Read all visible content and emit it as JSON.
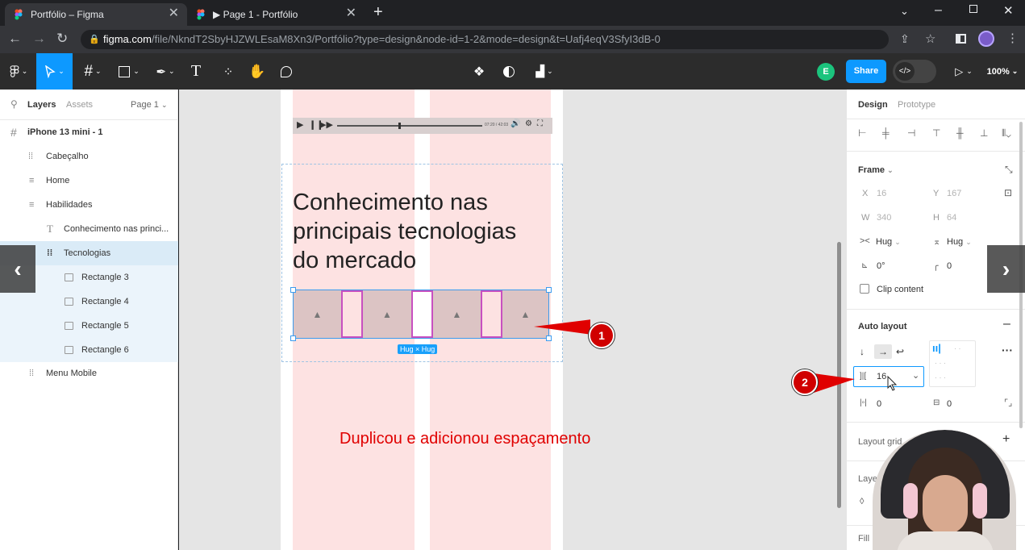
{
  "browser": {
    "tabs": [
      {
        "title": "Portfólio – Figma",
        "active": true
      },
      {
        "title": "▶ Page 1 - Portfólio",
        "active": false
      }
    ],
    "url_host": "figma.com",
    "url_path": "/file/NkndT2SbyHJZWLEsaM8Xn3/Portfólio?type=design&node-id=1-2&mode=design&t=Uafj4eqV3SfyI3dB-0"
  },
  "toolbar": {
    "share_label": "Share",
    "zoom": "100%",
    "avatar_letter": "E"
  },
  "left_panel": {
    "tab_layers": "Layers",
    "tab_assets": "Assets",
    "page_selector": "Page 1",
    "layers": [
      {
        "label": "iPhone 13 mini - 1",
        "icon": "frame-icon"
      },
      {
        "label": "Cabeçalho",
        "icon": "autolayout-icon"
      },
      {
        "label": "Home",
        "icon": "autolayout-icon"
      },
      {
        "label": "Habilidades",
        "icon": "autolayout-icon"
      },
      {
        "label": "Conhecimento nas princi...",
        "icon": "text-icon"
      },
      {
        "label": "Tecnologias",
        "icon": "autolayout-icon"
      },
      {
        "label": "Rectangle 3",
        "icon": "image-icon"
      },
      {
        "label": "Rectangle 4",
        "icon": "image-icon"
      },
      {
        "label": "Rectangle 5",
        "icon": "image-icon"
      },
      {
        "label": "Rectangle 6",
        "icon": "image-icon"
      },
      {
        "label": "Menu Mobile",
        "icon": "autolayout-icon"
      }
    ]
  },
  "canvas": {
    "heading_lines": [
      "Conhecimento nas",
      "principais tecnologias",
      "do mercado"
    ],
    "selection_badge": "Hug × Hug",
    "player_time": "07:20 / 42:03",
    "annotation_text": "Duplicou e adicionou espaçamento",
    "marker_1": "1",
    "marker_2": "2"
  },
  "right_panel": {
    "tab_design": "Design",
    "tab_prototype": "Prototype",
    "frame_title": "Frame",
    "x_label": "X",
    "x_value": "16",
    "y_label": "Y",
    "y_value": "167",
    "w_label": "W",
    "w_value": "340",
    "h_label": "H",
    "h_value": "64",
    "hug_h": "Hug",
    "hug_v": "Hug",
    "rotation": "0°",
    "radius": "0",
    "clip_content": "Clip content",
    "auto_layout_title": "Auto layout",
    "spacing_value": "16",
    "padding_h": "0",
    "padding_v": "0",
    "layout_grid_title": "Layout grid",
    "layer_title": "Layer",
    "fill_title": "Fill"
  },
  "colors": {
    "figma_blue": "#18a0fb",
    "selection_pink": "#c850c0",
    "column_pink": "#fde2e2",
    "annotation_red": "#e00000"
  }
}
